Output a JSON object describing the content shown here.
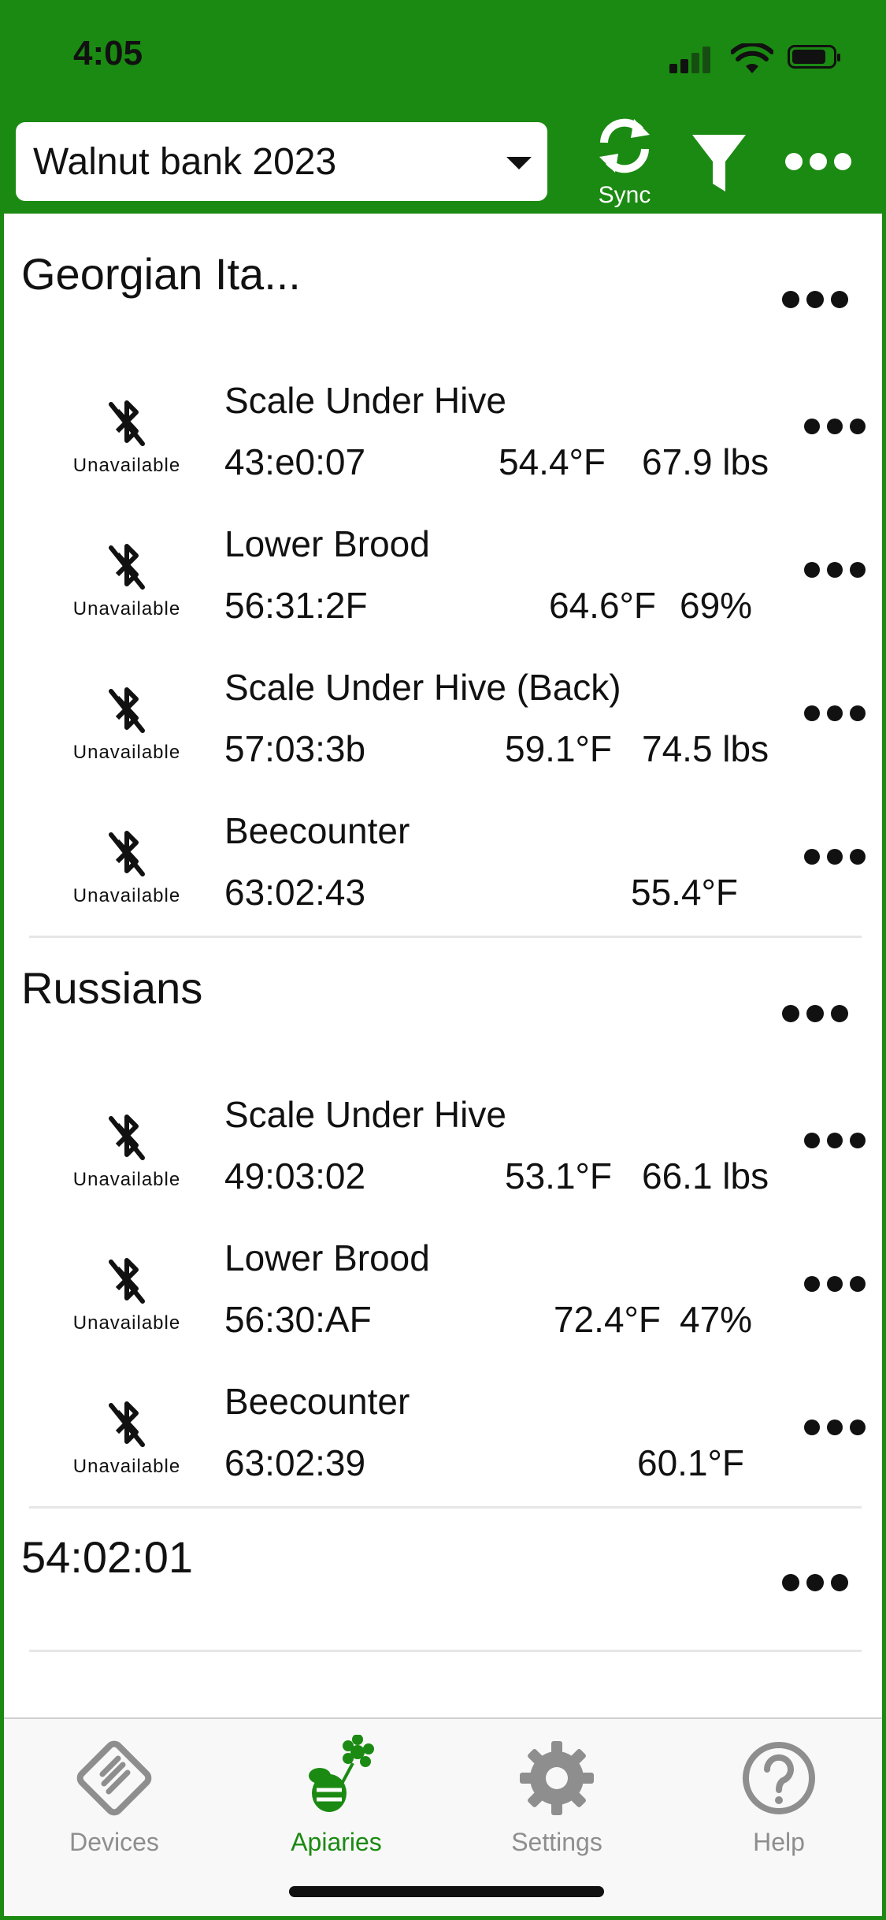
{
  "status_bar": {
    "time": "4:05"
  },
  "header": {
    "apiary_selected": "Walnut bank 2023",
    "sync_label": "Sync",
    "colors": {
      "brand": "#1b8a12"
    }
  },
  "groups": [
    {
      "title": "Georgian Ita...",
      "devices": [
        {
          "status": "Unavailable",
          "name": "Scale Under Hive",
          "id": "43:e0:07",
          "temp": "54.4°F",
          "extra": "67.9 lbs"
        },
        {
          "status": "Unavailable",
          "name": "Lower Brood",
          "id": "56:31:2F",
          "temp": "64.6°F",
          "extra": "69%"
        },
        {
          "status": "Unavailable",
          "name": "Scale Under Hive (Back)",
          "id": "57:03:3b",
          "temp": "59.1°F",
          "extra": "74.5 lbs"
        },
        {
          "status": "Unavailable",
          "name": "Beecounter",
          "id": "63:02:43",
          "temp": "55.4°F",
          "extra": ""
        }
      ]
    },
    {
      "title": "Russians",
      "devices": [
        {
          "status": "Unavailable",
          "name": "Scale Under Hive",
          "id": "49:03:02",
          "temp": "53.1°F",
          "extra": "66.1 lbs"
        },
        {
          "status": "Unavailable",
          "name": "Lower Brood",
          "id": "56:30:AF",
          "temp": "72.4°F",
          "extra": "47%"
        },
        {
          "status": "Unavailable",
          "name": "Beecounter",
          "id": "63:02:39",
          "temp": "60.1°F",
          "extra": ""
        }
      ]
    },
    {
      "title": "54:02:01",
      "devices": []
    }
  ],
  "tabs": [
    {
      "label": "Devices",
      "icon": "devices-icon",
      "active": false
    },
    {
      "label": "Apiaries",
      "icon": "apiaries-bee-icon",
      "active": true
    },
    {
      "label": "Settings",
      "icon": "gear-icon",
      "active": false
    },
    {
      "label": "Help",
      "icon": "help-icon",
      "active": false
    }
  ]
}
